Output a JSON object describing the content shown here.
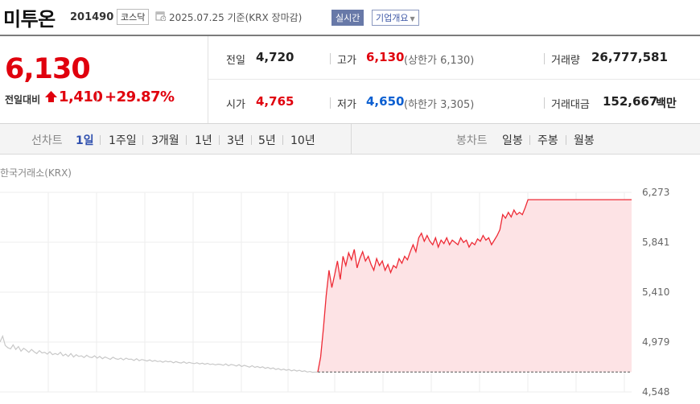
{
  "header": {
    "name": "미투온",
    "code": "201490",
    "market": "코스닥",
    "date_text": "2025.07.25 기준(KRX 장마감)",
    "realtime_label": "실시간",
    "company_info_label": "기업개요"
  },
  "price": {
    "current": "6,130",
    "change_label": "전일대비",
    "change": "1,410",
    "change_pct": "+29.87%"
  },
  "stats": {
    "prev_close": {
      "label": "전일",
      "value": "4,720"
    },
    "high": {
      "label": "고가",
      "value": "6,130",
      "sub": "(상한가 6,130)"
    },
    "volume": {
      "label": "거래량",
      "value": "26,777,581"
    },
    "open": {
      "label": "시가",
      "value": "4,765"
    },
    "low": {
      "label": "저가",
      "value": "4,650",
      "sub": "(하한가 3,305)"
    },
    "turnover": {
      "label": "거래대금",
      "value": "152,667",
      "unit": "백만"
    }
  },
  "toolbar": {
    "line_label": "선차트",
    "periods": [
      "1일",
      "1주일",
      "3개월",
      "1년",
      "3년",
      "5년",
      "10년"
    ],
    "selected_period": "1일",
    "candle_label": "봉차트",
    "candles": [
      "일봉",
      "주봉",
      "월봉"
    ]
  },
  "colors": {
    "up": "#e0000d",
    "down": "#0b5fd1",
    "selected": "#2e4fae",
    "fill": "#fde3e5",
    "prev_line": "#c8c8c8"
  },
  "chart_data": {
    "type": "line",
    "source_label": "한국거래소(KRX)",
    "yticks": [
      "6,273",
      "5,841",
      "5,410",
      "4,979",
      "4,548"
    ],
    "ylim": [
      4548,
      6273
    ],
    "baseline": 4720,
    "grid": true,
    "series": [
      {
        "values": [
          4980,
          5030,
          4950,
          4930,
          4920,
          4955,
          4915,
          4940,
          4900,
          4925,
          4910,
          4890,
          4915,
          4895,
          4880,
          4905,
          4885,
          4890,
          4875,
          4895,
          4870,
          4880,
          4870,
          4890,
          4860,
          4875,
          4855,
          4880,
          4850,
          4870,
          4855,
          4860,
          4845,
          4865,
          4850,
          4845,
          4860,
          4840,
          4855,
          4835,
          4850,
          4840,
          4830,
          4848,
          4835,
          4830,
          4840,
          4825,
          4840,
          4830,
          4832,
          4820,
          4835,
          4818,
          4828,
          4822,
          4815,
          4825,
          4812,
          4820,
          4810,
          4815,
          4805,
          4815,
          4808,
          4812,
          4800,
          4810,
          4802,
          4798,
          4808,
          4795,
          4803,
          4797,
          4793,
          4800,
          4790,
          4796,
          4787,
          4795,
          4785,
          4790,
          4782,
          4788,
          4785,
          4778,
          4790,
          4775,
          4785,
          4780,
          4772,
          4784,
          4768,
          4778,
          4770,
          4762,
          4775,
          4760,
          4768,
          4758,
          4765,
          4752,
          4760,
          4748,
          4755,
          4742,
          4750,
          4738,
          4745,
          4735,
          4742,
          4730,
          4738,
          4728,
          4735,
          4725,
          4730,
          4720,
          4725,
          4718,
          4720,
          4720
        ]
      },
      {
        "values": [
          4720,
          4850,
          5100,
          5380,
          5600,
          5450,
          5560,
          5680,
          5520,
          5720,
          5640,
          5750,
          5690,
          5780,
          5620,
          5700,
          5760,
          5680,
          5720,
          5650,
          5600,
          5700,
          5640,
          5680,
          5600,
          5650,
          5580,
          5640,
          5620,
          5700,
          5660,
          5720,
          5690,
          5760,
          5820,
          5760,
          5880,
          5920,
          5850,
          5900,
          5850,
          5820,
          5880,
          5800,
          5860,
          5830,
          5880,
          5820,
          5860,
          5840,
          5820,
          5880,
          5840,
          5860,
          5800,
          5840,
          5820,
          5870,
          5850,
          5900,
          5860,
          5880,
          5820,
          5860,
          5900,
          5950,
          6080,
          6050,
          6100,
          6060,
          6120,
          6080,
          6100,
          6080,
          6140,
          6210,
          6210,
          6210,
          6210,
          6210,
          6210,
          6210,
          6210,
          6210,
          6210,
          6210,
          6210,
          6210,
          6210,
          6210,
          6210,
          6210,
          6210,
          6210,
          6210,
          6210,
          6210,
          6210,
          6210,
          6210,
          6210,
          6210,
          6210,
          6210,
          6210,
          6210,
          6210,
          6210,
          6210,
          6210,
          6210,
          6210,
          6210
        ]
      }
    ]
  }
}
